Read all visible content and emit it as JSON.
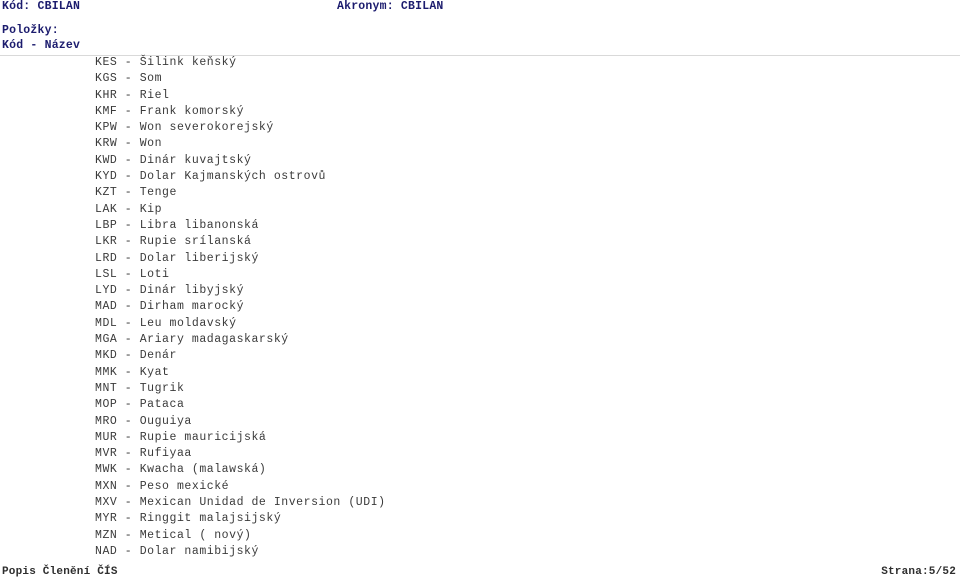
{
  "header": {
    "code_label": "Kód: CBILAN",
    "acronym_label": "Akronym: CBILAN",
    "items_label": "Položky:",
    "columns_label": "Kód - Název"
  },
  "colors": {
    "header_text": "#1c1c6e",
    "body_text": "#3a3a3a",
    "rule": "#d9d9d9",
    "background": "#ffffff"
  },
  "items": [
    "KES - Šilink keňský",
    "KGS - Som",
    "KHR - Riel",
    "KMF - Frank komorský",
    "KPW - Won severokorejský",
    "KRW - Won",
    "KWD - Dinár kuvajtský",
    "KYD - Dolar Kajmanských ostrovů",
    "KZT - Tenge",
    "LAK - Kip",
    "LBP - Libra libanonská",
    "LKR - Rupie srílanská",
    "LRD - Dolar liberijský",
    "LSL - Loti",
    "LYD - Dinár libyjský",
    "MAD - Dirham marocký",
    "MDL - Leu moldavský",
    "MGA - Ariary madagaskarský",
    "MKD - Denár",
    "MMK - Kyat",
    "MNT - Tugrik",
    "MOP - Pataca",
    "MRO - Ouguiya",
    "MUR - Rupie mauricijská",
    "MVR - Rufiyaa",
    "MWK - Kwacha (malawská)",
    "MXN - Peso mexické",
    "MXV - Mexican Unidad de Inversion (UDI)",
    "MYR - Ringgit malajsijský",
    "MZN - Metical ( nový)",
    "NAD - Dolar namibijský"
  ],
  "footer": {
    "title": "Popis Členění ČÍS",
    "page": "Strana:5/52"
  }
}
